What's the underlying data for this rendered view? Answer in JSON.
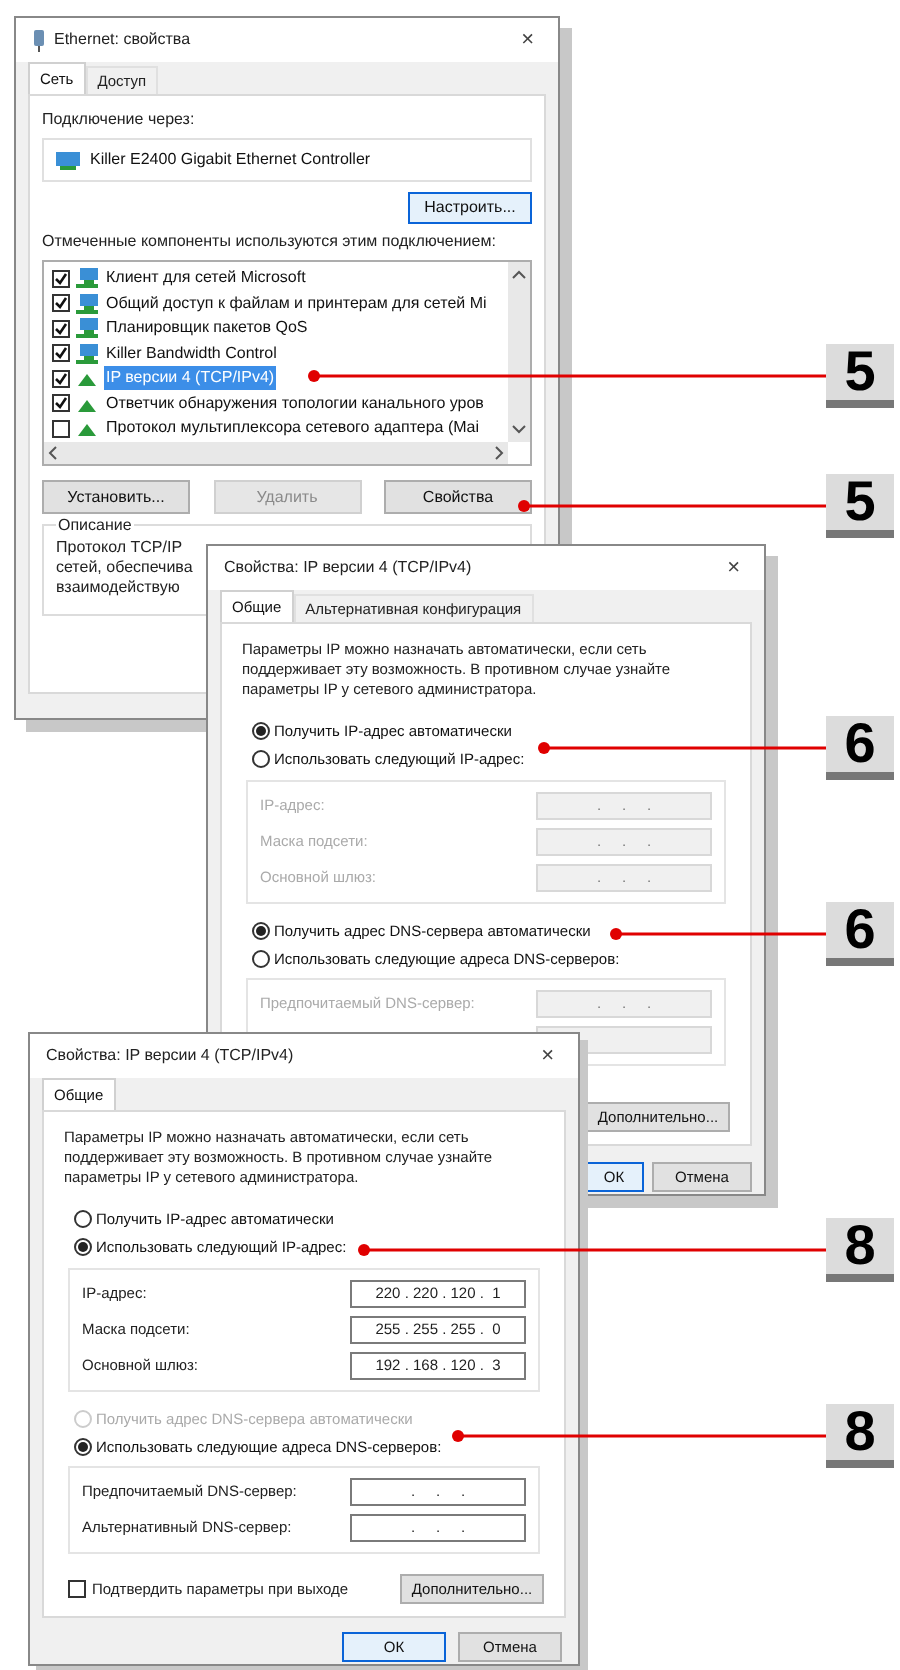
{
  "ethernet_dialog": {
    "title": "Ethernet: свойства",
    "close": "×",
    "tabs": [
      {
        "label": "Сеть",
        "selected": true
      },
      {
        "label": "Доступ",
        "selected": false
      }
    ],
    "connect_label": "Подключение через:",
    "adapter": "Killer E2400 Gigabit Ethernet Controller",
    "configure_button": "Настроить...",
    "components_label": "Отмеченные компоненты используются этим подключением:",
    "components": [
      {
        "kind": "service",
        "label": "Клиент для сетей Microsoft",
        "checked": true,
        "selected": false
      },
      {
        "kind": "service",
        "label": "Общий доступ к файлам и принтерам для сетей Mi",
        "checked": true,
        "selected": false
      },
      {
        "kind": "service",
        "label": "Планировщик пакетов QoS",
        "checked": true,
        "selected": false
      },
      {
        "kind": "service",
        "label": "Killer Bandwidth Control",
        "checked": true,
        "selected": false
      },
      {
        "kind": "protocol",
        "label": "IP версии 4 (TCP/IPv4)",
        "checked": true,
        "selected": true
      },
      {
        "kind": "protocol",
        "label": "Ответчик обнаружения топологии канального уров",
        "checked": true,
        "selected": false
      },
      {
        "kind": "protocol",
        "label": "Протокол мультиплексора сетевого адаптера (Mai",
        "checked": false,
        "selected": false
      }
    ],
    "buttons": [
      {
        "label": "Установить...",
        "disabled": false
      },
      {
        "label": "Удалить",
        "disabled": true
      },
      {
        "label": "Свойства",
        "disabled": false
      }
    ],
    "description_label": "Описание",
    "description_lines": [
      "Протокол TCP/IP",
      "сетей, обеспечива",
      "взаимодействую"
    ]
  },
  "ipv4_dialog_auto": {
    "title": "Свойства: IP версии 4 (TCP/IPv4)",
    "close": "×",
    "tabs": [
      {
        "label": "Общие",
        "selected": true
      },
      {
        "label": "Альтернативная конфигурация",
        "selected": false
      }
    ],
    "intro": "Параметры IP можно назначать автоматически, если сеть поддерживает эту возможность. В противном случае узнайте параметры IP у сетевого администратора.",
    "ip_modes": [
      {
        "label": "Получить IP-адрес автоматически",
        "selected": true,
        "disabled": false
      },
      {
        "label": "Использовать следующий IP-адрес:",
        "selected": false,
        "disabled": false
      }
    ],
    "ip_fields": [
      {
        "label": "IP-адрес:",
        "value": ".     .     .",
        "disabled": true
      },
      {
        "label": "Маска подсети:",
        "value": ".     .     .",
        "disabled": true
      },
      {
        "label": "Основной шлюз:",
        "value": ".     .     .",
        "disabled": true
      }
    ],
    "dns_modes": [
      {
        "label": "Получить адрес DNS-сервера автоматически",
        "selected": true,
        "disabled": false
      },
      {
        "label": "Использовать следующие адреса DNS-серверов:",
        "selected": false,
        "disabled": false
      }
    ],
    "dns_fields": [
      {
        "label": "Предпочитаемый DNS-сервер:",
        "value": ".     .     .",
        "disabled": true
      }
    ],
    "advanced_button": "Дополнительно...",
    "ok_button": "ОК",
    "cancel_button": "Отмена"
  },
  "ipv4_dialog_manual": {
    "title": "Свойства: IP версии 4 (TCP/IPv4)",
    "close": "×",
    "tabs": [
      {
        "label": "Общие",
        "selected": true
      }
    ],
    "intro": "Параметры IP можно назначать автоматически, если сеть поддерживает эту возможность. В противном случае узнайте параметры IP у сетевого администратора.",
    "ip_modes": [
      {
        "label": "Получить IP-адрес автоматически",
        "selected": false,
        "disabled": false
      },
      {
        "label": "Использовать следующий IP-адрес:",
        "selected": true,
        "disabled": false
      }
    ],
    "ip_fields": [
      {
        "label": "IP-адрес:",
        "value": "220 . 220 . 120 .  1",
        "disabled": false
      },
      {
        "label": "Маска подсети:",
        "value": "255 . 255 . 255 .  0",
        "disabled": false
      },
      {
        "label": "Основной шлюз:",
        "value": "192 . 168 . 120 .  3",
        "disabled": false
      }
    ],
    "dns_modes": [
      {
        "label": "Получить адрес DNS-сервера автоматически",
        "selected": false,
        "disabled": true
      },
      {
        "label": "Использовать следующие адреса DNS-серверов:",
        "selected": true,
        "disabled": false
      }
    ],
    "dns_fields": [
      {
        "label": "Предпочитаемый DNS-сервер:",
        "value": ".     .     .",
        "disabled": false
      },
      {
        "label": "Альтернативный DNS-сервер:",
        "value": ".     .     .",
        "disabled": false
      }
    ],
    "confirm": {
      "label": "Подтвердить параметры при выходе",
      "checked": false
    },
    "advanced_button": "Дополнительно...",
    "ok_button": "ОК",
    "cancel_button": "Отмена"
  },
  "callouts": [
    {
      "label": "5"
    },
    {
      "label": "5"
    },
    {
      "label": "6"
    },
    {
      "label": "6"
    },
    {
      "label": "8"
    },
    {
      "label": "8"
    }
  ]
}
